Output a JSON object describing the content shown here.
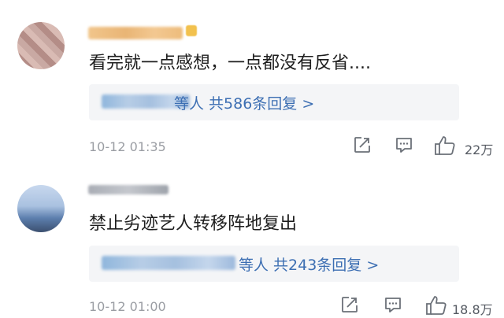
{
  "comments": [
    {
      "content": "看完就一点感想，一点都没有反省....",
      "reply_summary": "等人 共586条回复 >",
      "timestamp": "10-12 01:35",
      "likes": "22万",
      "icons": [
        "share-icon",
        "comment-icon",
        "like-icon"
      ]
    },
    {
      "content": "禁止劣迹艺人转移阵地复出",
      "reply_summary": "等人 共243条回复 >",
      "timestamp": "10-12 01:00",
      "likes": "18.8万",
      "icons": [
        "share-icon",
        "comment-icon",
        "like-icon"
      ]
    }
  ],
  "colors": {
    "link": "#3d6fb3",
    "meta": "#9a9da3",
    "reply_bg": "#f4f5f7"
  }
}
